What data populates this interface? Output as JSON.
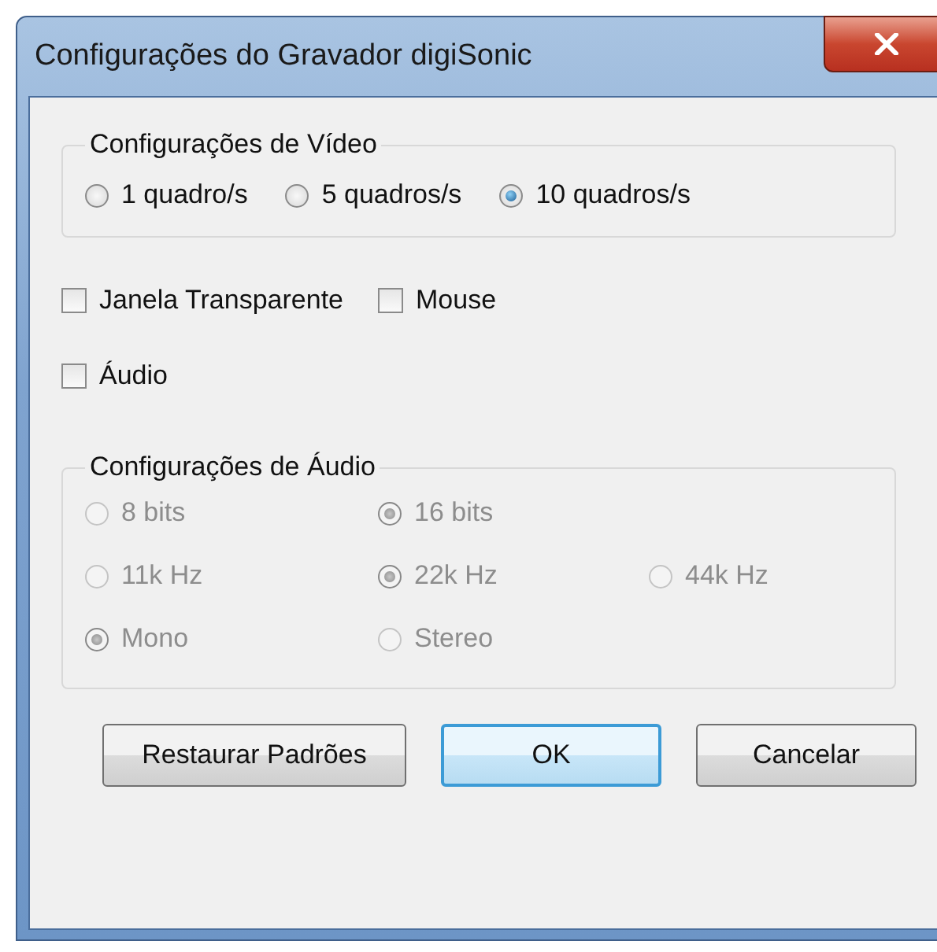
{
  "window": {
    "title": "Configurações do Gravador digiSonic"
  },
  "video": {
    "title": "Configurações de Vídeo",
    "options": [
      {
        "label": "1 quadro/s",
        "selected": false
      },
      {
        "label": "5 quadros/s",
        "selected": false
      },
      {
        "label": "10 quadros/s",
        "selected": true
      }
    ]
  },
  "checkbox_rows": [
    [
      {
        "label": "Janela Transparente",
        "checked": false
      },
      {
        "label": "Mouse",
        "checked": false
      }
    ],
    [
      {
        "label": "Áudio",
        "checked": false
      }
    ]
  ],
  "audio": {
    "title": "Configurações de Áudio",
    "disabled": true,
    "rows": [
      [
        {
          "label": "8 bits",
          "selected": false
        },
        {
          "label": "16 bits",
          "selected": true
        }
      ],
      [
        {
          "label": "11k Hz",
          "selected": false
        },
        {
          "label": "22k Hz",
          "selected": true
        },
        {
          "label": "44k Hz",
          "selected": false
        }
      ],
      [
        {
          "label": "Mono",
          "selected": true
        },
        {
          "label": "Stereo",
          "selected": false
        }
      ]
    ]
  },
  "buttons": [
    {
      "label": "Restaurar Padrões",
      "default": false
    },
    {
      "label": "OK",
      "default": true
    },
    {
      "label": "Cancelar",
      "default": false
    }
  ]
}
